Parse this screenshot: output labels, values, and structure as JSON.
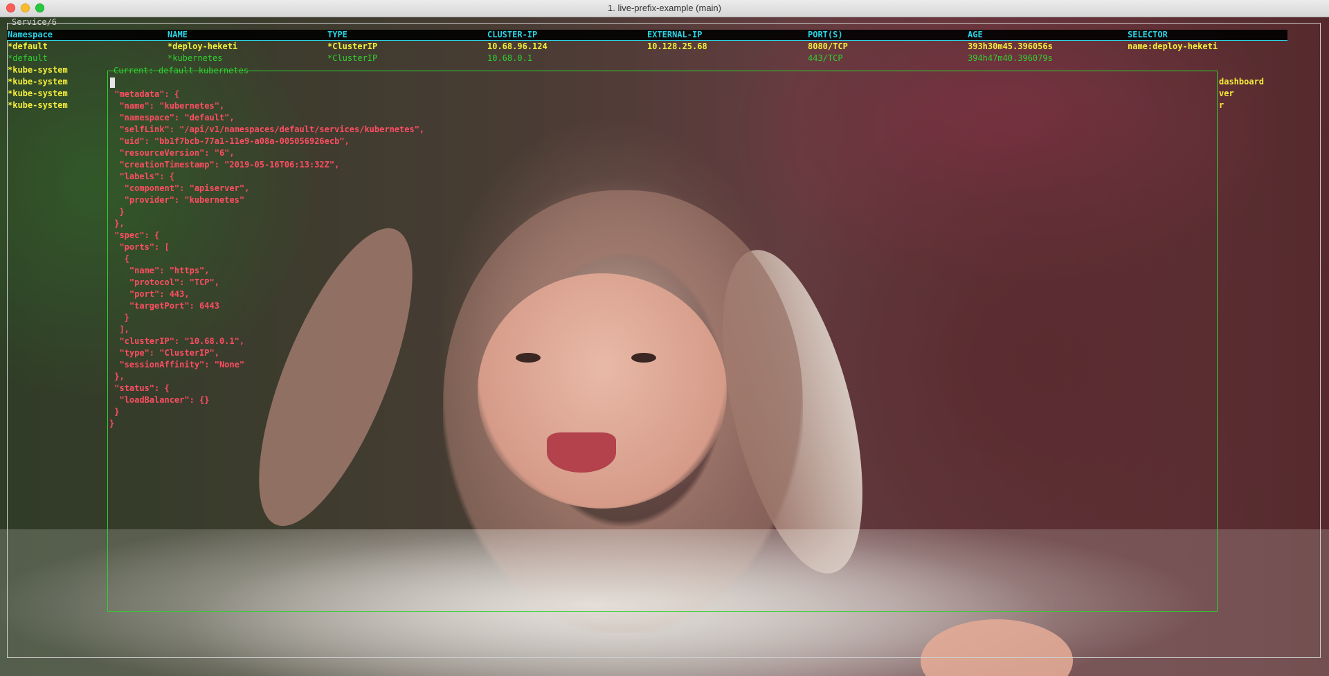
{
  "window": {
    "title": "1. live-prefix-example (main)"
  },
  "pane": {
    "label": "Service/6"
  },
  "table": {
    "headers": [
      "Namespace",
      "NAME",
      "TYPE",
      "CLUSTER-IP",
      "EXTERNAL-IP",
      "PORT(S)",
      "AGE",
      "SELECTOR"
    ],
    "rows": [
      [
        "*default",
        "*deploy-heketi",
        "*ClusterIP",
        "10.68.96.124",
        "10.128.25.68",
        "8080/TCP",
        "393h30m45.396056s",
        "name:deploy-heketi"
      ],
      [
        "*default",
        "*kubernetes",
        "*ClusterIP",
        "10.68.0.1",
        "",
        "443/TCP",
        "394h47m40.396079s",
        ""
      ],
      [
        "*kube-system",
        "",
        "",
        "",
        "",
        "",
        "",
        "dashboard"
      ],
      [
        "*kube-system",
        "",
        "",
        "",
        "",
        "",
        "",
        "ver"
      ],
      [
        "*kube-system",
        "",
        "",
        "",
        "",
        "",
        "",
        "r"
      ],
      [
        "*kube-system",
        "",
        "",
        "",
        "",
        "",
        "",
        ""
      ]
    ]
  },
  "detail": {
    "label": "Current: default kubernetes",
    "json_text": "{\n \"metadata\": {\n  \"name\": \"kubernetes\",\n  \"namespace\": \"default\",\n  \"selfLink\": \"/api/v1/namespaces/default/services/kubernetes\",\n  \"uid\": \"bb1f7bcb-77a1-11e9-a08a-005056926ecb\",\n  \"resourceVersion\": \"6\",\n  \"creationTimestamp\": \"2019-05-16T06:13:32Z\",\n  \"labels\": {\n   \"component\": \"apiserver\",\n   \"provider\": \"kubernetes\"\n  }\n },\n \"spec\": {\n  \"ports\": [\n   {\n    \"name\": \"https\",\n    \"protocol\": \"TCP\",\n    \"port\": 443,\n    \"targetPort\": 6443\n   }\n  ],\n  \"clusterIP\": \"10.68.0.1\",\n  \"type\": \"ClusterIP\",\n  \"sessionAffinity\": \"None\"\n },\n \"status\": {\n  \"loadBalancer\": {}\n }\n}"
  },
  "colors": {
    "header": "#29d3e3",
    "row_text": "#f5ee3a",
    "selected_row": "#2fd02f",
    "json_text": "#ff4d63",
    "outer_frame": "#cfcfcf",
    "detail_frame": "#2fd02f"
  }
}
